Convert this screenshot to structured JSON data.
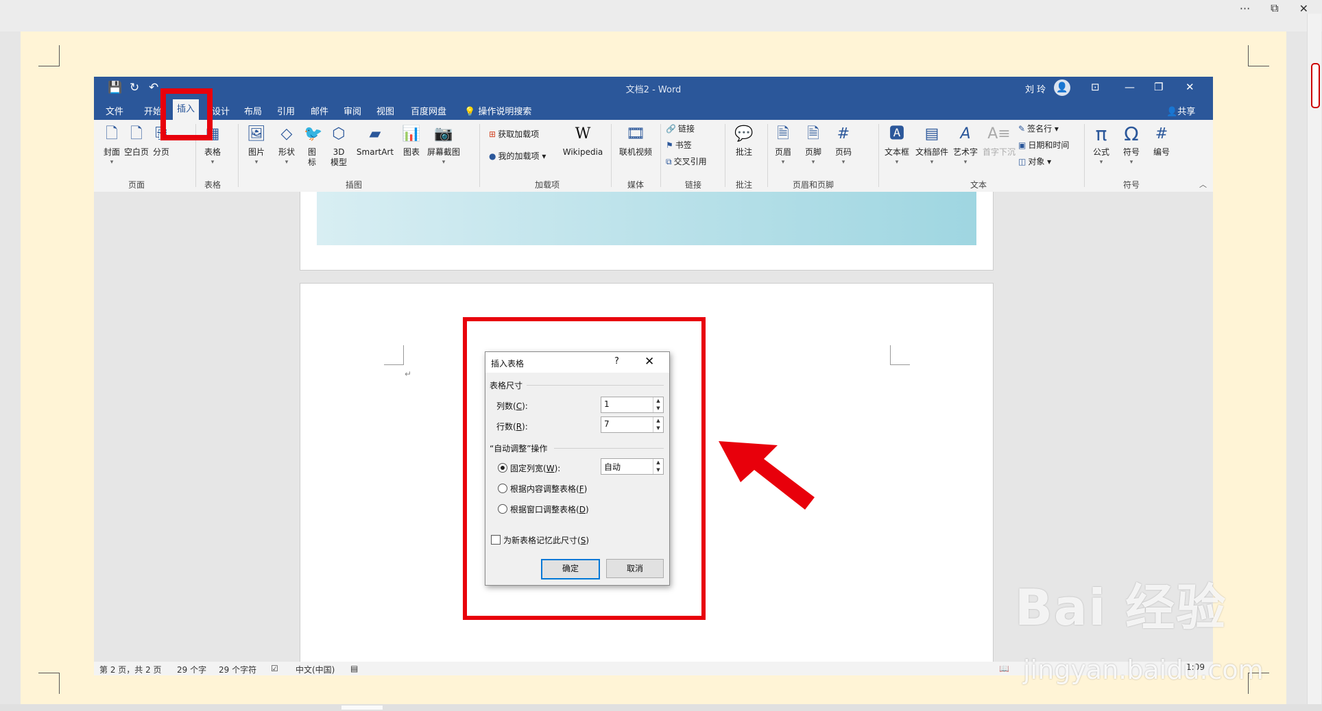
{
  "host": {
    "more": "···",
    "restore": "⧉",
    "close": "✕"
  },
  "word": {
    "title": "文档2  -  Word",
    "user": "刘 玲",
    "share": "共享",
    "qat": {
      "save": "💾",
      "redo": "↻",
      "undo": "↶"
    },
    "window": {
      "ribbon_opts": "⊡",
      "min": "—",
      "max": "❐",
      "close": "✕"
    },
    "tabs": [
      "文件",
      "开始",
      "插入",
      "设计",
      "布局",
      "引用",
      "邮件",
      "审阅",
      "视图",
      "百度网盘"
    ],
    "active_tab": "插入",
    "tell_me": "操作说明搜索",
    "ribbon": {
      "cover": "封面",
      "blank": "空白页",
      "break": "分页",
      "table": "表格",
      "picture": "图片",
      "shapes": "形状",
      "icons": "图\n标",
      "model3d": "3D\n模型",
      "smartart": "SmartArt",
      "chart": "图表",
      "screenshot": "屏幕截图",
      "get_addins": "获取加载项",
      "my_addins": "我的加载项",
      "wikipedia": "Wikipedia",
      "online_video": "联机视频",
      "link": "链接",
      "bookmark": "书签",
      "crossref": "交叉引用",
      "comment": "批注",
      "header": "页眉",
      "footer": "页脚",
      "pagenum": "页码",
      "textbox": "文本框",
      "quickparts": "文档部件",
      "wordart": "艺术字",
      "dropcap": "首字下沉",
      "signature": "签名行",
      "datetime": "日期和时间",
      "object": "对象",
      "equation": "公式",
      "symbol": "符号",
      "numbering": "编号"
    },
    "groups": {
      "pages": "页面",
      "tables": "表格",
      "illustrations": "插图",
      "addins": "加载项",
      "media": "媒体",
      "links": "链接",
      "comments": "批注",
      "headerfooter": "页眉和页脚",
      "text": "文本",
      "symbols": "符号"
    },
    "status": {
      "page": "第 2 页，共 2 页",
      "words": "29 个字",
      "chars": "29 个字符",
      "lang": "中文(中国)",
      "zoom": "1:09"
    }
  },
  "dialog": {
    "title": "插入表格",
    "help": "?",
    "close": "✕",
    "section_size": "表格尺寸",
    "cols_label": "列数(",
    "cols_key": "C",
    "cols_suffix": "):",
    "cols_value": "1",
    "rows_label": "行数(",
    "rows_key": "R",
    "rows_suffix": "):",
    "rows_value": "7",
    "section_autofit": "“自动调整”操作",
    "fixed_label": "固定列宽(",
    "fixed_key": "W",
    "fixed_suffix": "):",
    "fixed_value": "自动",
    "content_label": "根据内容调整表格(",
    "content_key": "F",
    "content_suffix": ")",
    "window_label": "根据窗口调整表格(",
    "window_key": "D",
    "window_suffix": ")",
    "remember_label": "为新表格记忆此尺寸(",
    "remember_key": "S",
    "remember_suffix": ")",
    "ok": "确定",
    "cancel": "取消",
    "selected_option": "fixed",
    "remember_checked": false
  },
  "annotation": {
    "color": "#e8000b"
  },
  "watermark": {
    "logo": "Bai 经验",
    "url": "jingyan.baidu.com"
  }
}
